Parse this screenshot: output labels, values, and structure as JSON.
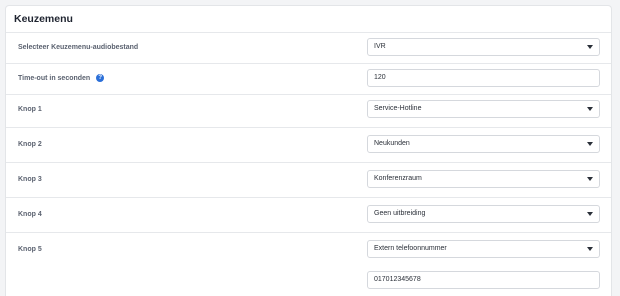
{
  "panel": {
    "title": "Keuzemenu"
  },
  "rows": [
    {
      "label": "Selecteer Keuzemenu-audiobestand",
      "value": "IVR",
      "kind": "select"
    },
    {
      "label": "Time-out in seconden",
      "value": "120",
      "kind": "input",
      "help_icon": "help-icon"
    },
    {
      "label": "Knop 1",
      "value": "Service-Hotline",
      "kind": "select"
    },
    {
      "label": "Knop 2",
      "value": "Neukunden",
      "kind": "select"
    },
    {
      "label": "Knop 3",
      "value": "Konferenzraum",
      "kind": "select"
    },
    {
      "label": "Knop 4",
      "value": "Geen uitbreiding",
      "kind": "select"
    },
    {
      "label": "Knop 5",
      "value": "Extern telefoonnummer",
      "kind": "select",
      "extra_input_value": "017012345678"
    }
  ],
  "colors": {
    "help_icon": "#2b6fd8",
    "title_text": "#1f2430",
    "label_text": "#5b6270"
  }
}
